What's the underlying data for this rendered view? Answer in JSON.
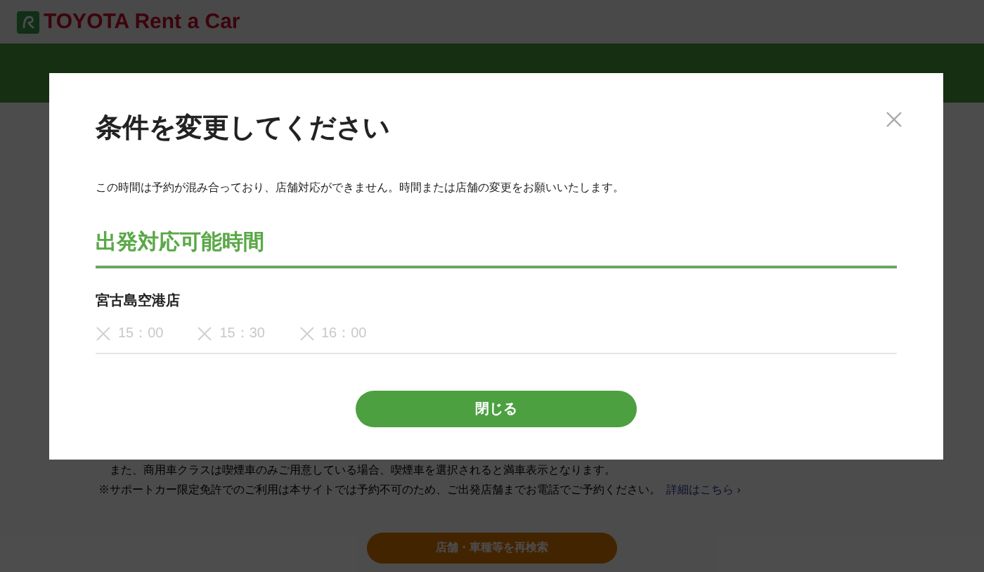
{
  "header": {
    "brand": "TOYOTA Rent a Car"
  },
  "notes": [
    {
      "text": "また、商用車クラスは喫煙車のみご用意している場合、喫煙車を選択されると満車表示となります。"
    },
    {
      "text": "※サポートカー限定免許でのご利用は本サイトでは予約不可のため、ご出発店舗までお電話でご予約ください。",
      "link": "詳細はこちら ›"
    }
  ],
  "search_button": "店舗・車種等を再検索",
  "modal": {
    "title": "条件を変更してください",
    "message": "この時間は予約が混み合っており、店舗対応ができません。時間または店舗の変更をお願いいたします。",
    "section_title": "出発対応可能時間",
    "stores": [
      {
        "name": "宮古島空港店",
        "slots": [
          {
            "time": "15：00",
            "available": false
          },
          {
            "time": "15：30",
            "available": false
          },
          {
            "time": "16：00",
            "available": false
          }
        ]
      }
    ],
    "close_button": "閉じる"
  }
}
